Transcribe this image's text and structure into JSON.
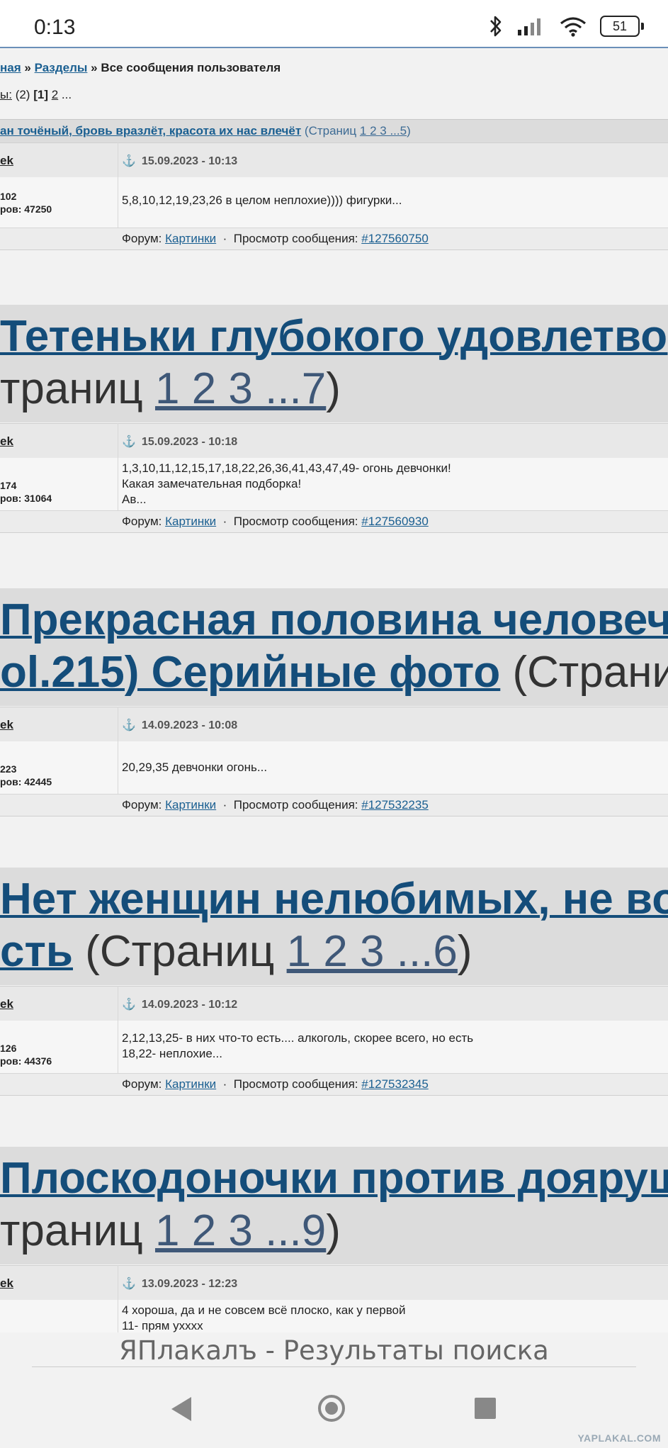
{
  "status_bar": {
    "time": "0:13",
    "battery": "51"
  },
  "breadcrumbs": {
    "home": "ная",
    "sections": "Разделы",
    "current": "Все сообщения пользователя",
    "sep": "»"
  },
  "pager": {
    "label": "ы:",
    "count": "(2)",
    "current": "[1]",
    "next": "2",
    "more": "..."
  },
  "topics": [
    {
      "title": "ан точёный, бровь вразлёт, красота их нас влечёт",
      "pages_prefix": "(Страниц",
      "pages": "1 2 3 ...5",
      "pages_suffix": ")"
    },
    {
      "title_line1": "Тетеньки глубокого удовлетвор",
      "line2_prefix": "траниц",
      "pages": "1 2 3 ...7",
      "pages_suffix": ")"
    },
    {
      "title_line1": "Прекрасная половина человече",
      "title_line2": "ol.215) Серийные фото",
      "line2_suffix": "(Страни"
    },
    {
      "title_line1": "Нет женщин нелюбимых, не во",
      "title_line2": "сть",
      "line2_prefix": "(Страниц",
      "pages": "1 2 3 ...6",
      "pages_suffix": ")"
    },
    {
      "title_line1": "Плоскодоночки против доярущ",
      "line2_prefix": "траниц",
      "pages": "1 2 3 ...9",
      "pages_suffix": ")"
    }
  ],
  "posts": [
    {
      "user": "ek",
      "date": "15.09.2023 - 10:13",
      "stat1": "102",
      "stat2_label": "ров:",
      "stat2": "47250",
      "text": "5,8,10,12,19,23,26 в целом неплохие)))) фигурки...",
      "forum": "Картинки",
      "msg_id": "#127560750"
    },
    {
      "user": "ek",
      "date": "15.09.2023 - 10:18",
      "stat1": "174",
      "stat2_label": "ров:",
      "stat2": "31064",
      "text": "1,3,10,11,12,15,17,18,22,26,36,41,43,47,49- огонь девчонки!\nКакая замечательная подборка!\nАв...",
      "forum": "Картинки",
      "msg_id": "#127560930"
    },
    {
      "user": "ek",
      "date": "14.09.2023 - 10:08",
      "stat1": "223",
      "stat2_label": "ров:",
      "stat2": "42445",
      "text": "20,29,35 девчонки огонь...",
      "forum": "Картинки",
      "msg_id": "#127532235"
    },
    {
      "user": "ek",
      "date": "14.09.2023 - 10:12",
      "stat1": "126",
      "stat2_label": "ров:",
      "stat2": "44376",
      "text": "2,12,13,25- в них что-то есть.... алкоголь, скорее всего, но есть\n18,22- неплохие...",
      "forum": "Картинки",
      "msg_id": "#127532345"
    },
    {
      "user": "ek",
      "date": "13.09.2023 - 12:23",
      "text": "4 хороша, да и не совсем всё плоско, как у первой\n11- прям ухххх"
    }
  ],
  "labels": {
    "forum": "Форум:",
    "view": "Просмотр сообщения:",
    "dot": "·"
  },
  "page_title": "ЯПлакалъ - Результаты поиска",
  "watermark": "YAPLAKAL.COM",
  "colors": {
    "link": "#1a5f91",
    "big_title": "#144d7a",
    "header_bg": "#e8e8e8",
    "topic_bg": "#dcdcdc"
  }
}
